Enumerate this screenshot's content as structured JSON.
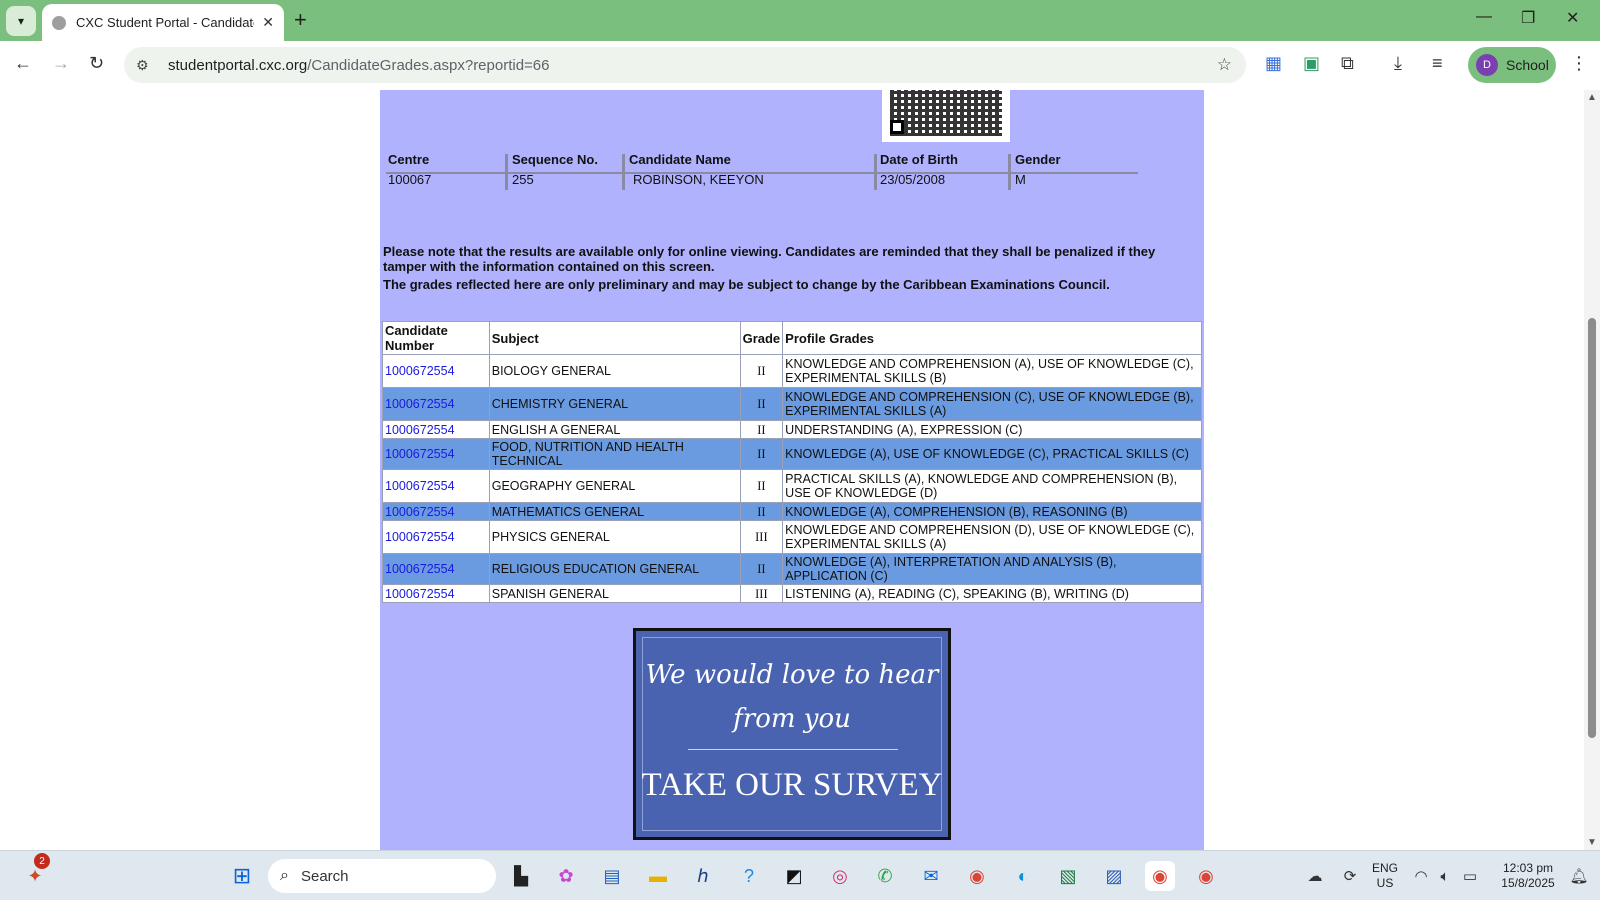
{
  "browser": {
    "tab_title": "CXC Student Portal - Candidate",
    "url_host": "studentportal.cxc.org",
    "url_path": "/CandidateGrades.aspx?reportid=66",
    "profile_initial": "D",
    "profile_label": "School"
  },
  "candidate_info": {
    "centre_label": "Centre",
    "centre": "100067",
    "sequence_label": "Sequence No.",
    "sequence": "255",
    "name_label": "Candidate Name",
    "name": "ROBINSON, KEEYON",
    "dob_label": "Date of Birth",
    "dob": "23/05/2008",
    "gender_label": "Gender",
    "gender": "M"
  },
  "notices": {
    "line1": "Please note that the results are available only for online viewing. Candidates are reminded that they shall be penalized if they tamper with the information contained on this screen.",
    "line2": "The grades reflected here are only preliminary and may be subject to change by the Caribbean Examinations Council."
  },
  "grades_table": {
    "headers": [
      "Candidate Number",
      "Subject",
      "Grade",
      "Profile Grades"
    ],
    "rows": [
      {
        "number": "1000672554",
        "subject": "BIOLOGY GENERAL",
        "grade": "II",
        "profile": "KNOWLEDGE AND COMPREHENSION (A), USE OF KNOWLEDGE (C), EXPERIMENTAL SKILLS (B)"
      },
      {
        "number": "1000672554",
        "subject": "CHEMISTRY GENERAL",
        "grade": "II",
        "profile": "KNOWLEDGE AND COMPREHENSION (C), USE OF KNOWLEDGE (B), EXPERIMENTAL SKILLS (A)"
      },
      {
        "number": "1000672554",
        "subject": "ENGLISH A GENERAL",
        "grade": "II",
        "profile": "UNDERSTANDING (A), EXPRESSION (C)"
      },
      {
        "number": "1000672554",
        "subject": "FOOD, NUTRITION AND HEALTH TECHNICAL",
        "grade": "II",
        "profile": "KNOWLEDGE (A), USE OF KNOWLEDGE (C), PRACTICAL SKILLS (C)"
      },
      {
        "number": "1000672554",
        "subject": "GEOGRAPHY GENERAL",
        "grade": "II",
        "profile": "PRACTICAL SKILLS (A), KNOWLEDGE AND COMPREHENSION (B), USE OF KNOWLEDGE (D)"
      },
      {
        "number": "1000672554",
        "subject": "MATHEMATICS GENERAL",
        "grade": "II",
        "profile": "KNOWLEDGE (A), COMPREHENSION (B), REASONING (B)"
      },
      {
        "number": "1000672554",
        "subject": "PHYSICS GENERAL",
        "grade": "III",
        "profile": "KNOWLEDGE AND COMPREHENSION (D), USE OF KNOWLEDGE (C), EXPERIMENTAL SKILLS (A)"
      },
      {
        "number": "1000672554",
        "subject": "RELIGIOUS EDUCATION GENERAL",
        "grade": "II",
        "profile": "KNOWLEDGE (A), INTERPRETATION AND ANALYSIS (B), APPLICATION (C)"
      },
      {
        "number": "1000672554",
        "subject": "SPANISH GENERAL",
        "grade": "III",
        "profile": "LISTENING (A), READING (C), SPEAKING (B), WRITING (D)"
      }
    ]
  },
  "survey": {
    "line1": "We would love to hear",
    "line2": "from you",
    "cta": "TAKE OUR SURVEY"
  },
  "taskbar": {
    "search_placeholder": "Search",
    "notification_count": "2",
    "lang": "ENG",
    "region": "US",
    "time": "12:03 pm",
    "date": "15/8/2025"
  },
  "colors": {
    "page_bg": "#b0b2fe",
    "alt_row": "#6a9be0",
    "link": "#1a1ae0",
    "chrome_green": "#7bbf7e",
    "survey_bg": "#4963b1"
  }
}
